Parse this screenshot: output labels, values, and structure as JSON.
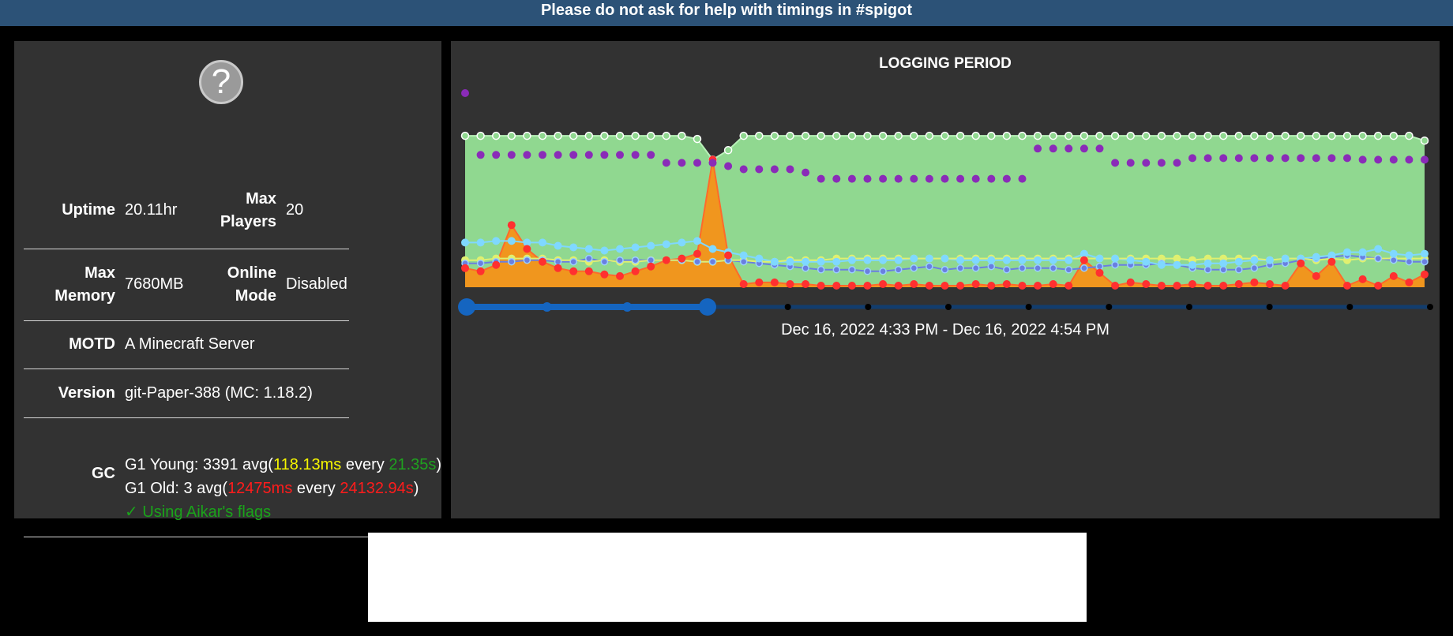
{
  "banner": {
    "text": "Please do not ask for help with timings in #spigot"
  },
  "server": {
    "icon": "question-mark-icon",
    "icon_glyph": "?",
    "uptime_label": "Uptime",
    "uptime_value": "20.11hr",
    "max_players_label_1": "Max",
    "max_players_label_2": "Players",
    "max_players_value": "20",
    "max_memory_label_1": "Max",
    "max_memory_label_2": "Memory",
    "max_memory_value": "7680MB",
    "online_mode_label_1": "Online",
    "online_mode_label_2": "Mode",
    "online_mode_value": "Disabled",
    "motd_label": "MOTD",
    "motd_value": "A Minecraft Server",
    "version_label": "Version",
    "version_value": "git-Paper-388 (MC: 1.18.2)"
  },
  "gc": {
    "label": "GC",
    "young_prefix": "G1 Young: 3391 avg(",
    "young_ms": "118.13ms",
    "young_every": " every ",
    "young_interval": "21.35s",
    "young_suffix": ")",
    "old_prefix": "G1 Old: 3 avg(",
    "old_ms": "12475ms",
    "old_every": " every ",
    "old_interval": "24132.94s",
    "old_suffix": ")",
    "flags": "✓ Using Aikar's flags"
  },
  "chart": {
    "title": "LOGGING PERIOD",
    "range_text": "Dec 16, 2022 4:33 PM - Dec 16, 2022 4:54 PM",
    "colors": {
      "tps": "#90d890",
      "lag": "#ff3030",
      "lag_fill": "#f0961e",
      "purple": "#8a2bb8",
      "cyan": "#7fd8ff",
      "blue": "#6a7fe0",
      "yellow": "#e0f070",
      "slider": "#1565c0",
      "track": "#123d6e"
    }
  },
  "chart_data": {
    "type": "area",
    "title": "LOGGING PERIOD",
    "x_points": 63,
    "ylim": [
      0,
      100
    ],
    "series": [
      {
        "values": [
          95,
          95,
          95,
          95,
          95,
          95,
          95,
          95,
          95,
          95,
          95,
          95,
          95,
          95,
          95,
          93,
          80,
          86,
          95,
          95,
          95,
          95,
          95,
          95,
          95,
          95,
          95,
          95,
          95,
          95,
          95,
          95,
          95,
          95,
          95,
          95,
          95,
          95,
          95,
          95,
          95,
          95,
          95,
          95,
          95,
          95,
          95,
          95,
          95,
          95,
          95,
          95,
          95,
          95,
          95,
          95,
          95,
          95,
          95,
          95,
          95,
          95,
          92
        ]
      },
      {
        "values": [
          12,
          10,
          14,
          39,
          24,
          16,
          12,
          10,
          10,
          8,
          7,
          10,
          13,
          17,
          18,
          21,
          80,
          20,
          2,
          3,
          3,
          2,
          2,
          1,
          1,
          1,
          1,
          2,
          1,
          2,
          1,
          1,
          1,
          2,
          1,
          2,
          1,
          1,
          2,
          1,
          17,
          9,
          1,
          3,
          2,
          1,
          1,
          2,
          1,
          1,
          2,
          3,
          2,
          1,
          15,
          7,
          16,
          1,
          5,
          1,
          7,
          3,
          8
        ]
      },
      {
        "values": [
          111,
          83,
          83,
          83,
          83,
          83,
          83,
          83,
          83,
          83,
          83,
          83,
          83,
          78,
          78,
          78,
          78,
          76,
          74,
          74,
          74,
          74,
          72,
          68,
          68,
          68,
          68,
          68,
          68,
          68,
          68,
          68,
          68,
          68,
          68,
          68,
          68,
          87,
          87,
          87,
          87,
          87,
          78,
          78,
          78,
          78,
          78,
          81,
          81,
          81,
          81,
          81,
          81,
          81,
          81,
          81,
          81,
          81,
          80,
          80,
          80,
          80,
          80
        ]
      },
      {
        "values": [
          15,
          15,
          16,
          16,
          17,
          17,
          16,
          16,
          18,
          16,
          17,
          17,
          17,
          17,
          17,
          16,
          16,
          17,
          16,
          15,
          14,
          13,
          12,
          11,
          11,
          11,
          10,
          10,
          11,
          12,
          13,
          11,
          12,
          12,
          13,
          11,
          12,
          12,
          12,
          11,
          12,
          13,
          14,
          14,
          14,
          15,
          14,
          12,
          11,
          11,
          11,
          12,
          14,
          15,
          17,
          18,
          19,
          20,
          19,
          18,
          17,
          16,
          16
        ]
      },
      {
        "values": [
          28,
          28,
          29,
          29,
          28,
          28,
          26,
          25,
          24,
          23,
          24,
          25,
          26,
          27,
          28,
          29,
          24,
          22,
          20,
          18,
          16,
          16,
          16,
          16,
          16,
          17,
          17,
          17,
          17,
          18,
          18,
          18,
          17,
          17,
          17,
          17,
          17,
          17,
          17,
          17,
          21,
          18,
          18,
          17,
          16,
          14,
          14,
          14,
          15,
          15,
          16,
          17,
          17,
          18,
          18,
          19,
          20,
          22,
          22,
          24,
          21,
          20,
          21
        ]
      },
      {
        "values": [
          17,
          17,
          18,
          18,
          18,
          18,
          17,
          17,
          16,
          17,
          16,
          16,
          17,
          17,
          17,
          16,
          16,
          17,
          17,
          16,
          16,
          17,
          17,
          17,
          18,
          18,
          18,
          18,
          18,
          18,
          18,
          18,
          18,
          18,
          18,
          18,
          18,
          18,
          18,
          18,
          18,
          18,
          18,
          18,
          18,
          18,
          18,
          17,
          18,
          18,
          18,
          18,
          17,
          18,
          18,
          17,
          18,
          17,
          18,
          18,
          18,
          18,
          18
        ]
      }
    ],
    "slider_fraction": [
      0.0,
      0.25
    ],
    "timeline_ticks": 12
  }
}
